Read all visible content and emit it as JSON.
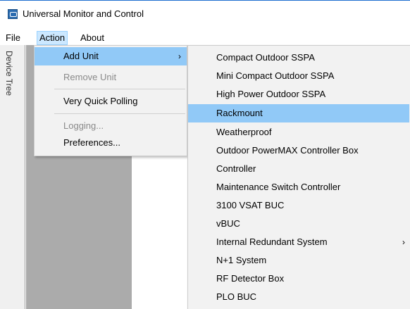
{
  "window": {
    "title": "Universal Monitor and Control"
  },
  "menubar": {
    "items": [
      "File",
      "Action",
      "About"
    ],
    "active": "Action"
  },
  "device_tree": {
    "label": "Device Tree"
  },
  "action_menu": {
    "items": [
      {
        "label": "Add Unit",
        "submenu_arrow": "›",
        "state": "highlighted"
      },
      {
        "label": "Remove Unit",
        "state": "disabled"
      },
      {
        "label": "Very Quick Polling",
        "state": "enabled"
      },
      {
        "label": "Logging...",
        "state": "disabled"
      },
      {
        "label": "Preferences...",
        "state": "enabled"
      }
    ]
  },
  "add_unit_submenu": {
    "items": [
      {
        "label": "Compact Outdoor SSPA"
      },
      {
        "label": "Mini Compact Outdoor SSPA"
      },
      {
        "label": "High Power Outdoor SSPA"
      },
      {
        "label": "Rackmount",
        "state": "highlighted"
      },
      {
        "label": "Weatherproof"
      },
      {
        "label": "Outdoor PowerMAX Controller Box"
      },
      {
        "label": "Controller"
      },
      {
        "label": "Maintenance Switch Controller"
      },
      {
        "label": "3100 VSAT BUC"
      },
      {
        "label": "vBUC"
      },
      {
        "label": "Internal Redundant System",
        "submenu_arrow": "›"
      },
      {
        "label": "N+1 System"
      },
      {
        "label": "RF Detector Box"
      },
      {
        "label": "PLO BUC"
      }
    ]
  },
  "colors": {
    "highlight": "#91c9f7",
    "menubar_active": "#cce8ff",
    "disabled_text": "#8a8a8a",
    "background_grey": "#ababab"
  }
}
